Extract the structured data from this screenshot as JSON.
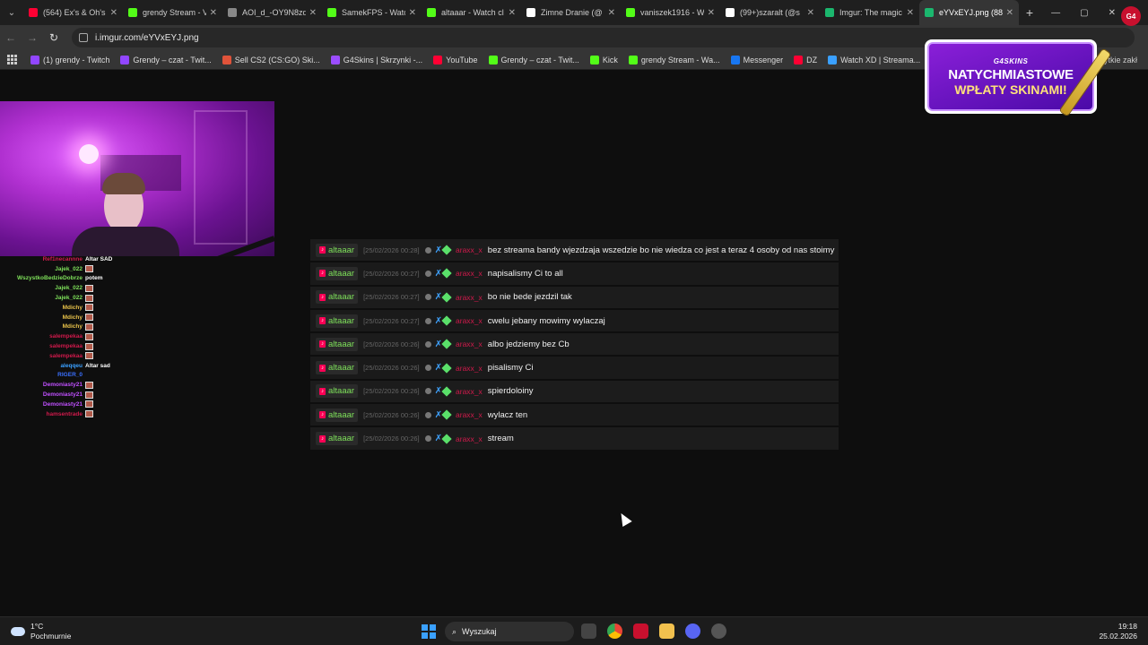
{
  "browser": {
    "tabs": [
      {
        "label": "(564) Ex's & Oh's",
        "icon": "youtube-icon",
        "color": "#ff0033"
      },
      {
        "label": "grendy Stream - V",
        "icon": "kick-icon",
        "color": "#53fc18"
      },
      {
        "label": "AOI_d_-OY9N8zd",
        "icon": "globe-icon",
        "color": "#888888"
      },
      {
        "label": "SamekFPS - Watc",
        "icon": "kick-icon",
        "color": "#53fc18"
      },
      {
        "label": "altaaar - Watch cl",
        "icon": "kick-icon",
        "color": "#53fc18"
      },
      {
        "label": "Zimne Dranie (@",
        "icon": "tiktok-icon",
        "color": "#ffffff"
      },
      {
        "label": "vaniszek1916 - W",
        "icon": "kick-icon",
        "color": "#53fc18"
      },
      {
        "label": "(99+)szaralt (@s",
        "icon": "tiktok-icon",
        "color": "#ffffff"
      },
      {
        "label": "Imgur: The magic",
        "icon": "imgur-icon",
        "color": "#1bb76e"
      },
      {
        "label": "eYVxEYJ.png (88",
        "icon": "image-icon",
        "color": "#1bb76e",
        "active": true
      }
    ],
    "url": "i.imgur.com/eYVxEYJ.png",
    "bookmarks": [
      {
        "label": "(1) grendy - Twitch",
        "color": "#9146ff"
      },
      {
        "label": "Grendy – czat - Twit...",
        "color": "#9146ff"
      },
      {
        "label": "Sell CS2 (CS:GO) Ski...",
        "color": "#e0533a"
      },
      {
        "label": "G4Skins | Skrzynki -...",
        "color": "#9b4dff"
      },
      {
        "label": "YouTube",
        "color": "#ff0033"
      },
      {
        "label": "Grendy – czat - Twit...",
        "color": "#53fc18"
      },
      {
        "label": "Kick",
        "color": "#53fc18"
      },
      {
        "label": "grendy Stream - Wa...",
        "color": "#53fc18"
      },
      {
        "label": "Messenger",
        "color": "#1877f2"
      },
      {
        "label": "DZ",
        "color": "#ff0033"
      },
      {
        "label": "Watch XD | Streama...",
        "color": "#3aa0ff"
      }
    ],
    "all_bookmarks": "ytkie zakł"
  },
  "promo": {
    "brand": "G4SKINS",
    "line1": "NATYCHMIASTOWE",
    "line2": "WPŁATY SKINAMI!",
    "ext_badge": "G4"
  },
  "side_chat": [
    {
      "name": "Ref1necannne",
      "msg": "Altar SAD",
      "color": "#d11a4c",
      "emote": false
    },
    {
      "name": "Jajek_022",
      "msg": "",
      "color": "#7ee05a",
      "emote": true
    },
    {
      "name": "WszystkoBedzieDobrze",
      "msg": "potem",
      "color": "#7ee05a",
      "emote": false
    },
    {
      "name": "Jajek_022",
      "msg": "",
      "color": "#7ee05a",
      "emote": true
    },
    {
      "name": "Jajek_022",
      "msg": "",
      "color": "#7ee05a",
      "emote": true
    },
    {
      "name": "Mdichy",
      "msg": "",
      "color": "#e8c24a",
      "emote": true
    },
    {
      "name": "Mdichy",
      "msg": "",
      "color": "#e8c24a",
      "emote": true
    },
    {
      "name": "Mdichy",
      "msg": "",
      "color": "#e8c24a",
      "emote": true
    },
    {
      "name": "salempekaa",
      "msg": "",
      "color": "#d11a4c",
      "emote": true
    },
    {
      "name": "salempekaa",
      "msg": "",
      "color": "#d11a4c",
      "emote": true
    },
    {
      "name": "salempekaa",
      "msg": "",
      "color": "#d11a4c",
      "emote": true
    },
    {
      "name": "aleqqeu",
      "msg": "Altar sad",
      "color": "#3aa0ff",
      "emote": false
    },
    {
      "name": "RIGER_0",
      "msg": "",
      "color": "#3a70ff",
      "emote": false
    },
    {
      "name": "Demoniasty21",
      "msg": "",
      "color": "#c050ff",
      "emote": true
    },
    {
      "name": "Demoniasty21",
      "msg": "",
      "color": "#c050ff",
      "emote": true
    },
    {
      "name": "Demoniasty21",
      "msg": "",
      "color": "#c050ff",
      "emote": true
    },
    {
      "name": "hamsentrade",
      "msg": "",
      "color": "#d11a4c",
      "emote": true
    }
  ],
  "chat_log": [
    {
      "user": "altaaar",
      "ts": "[25/02/2026 00:28]",
      "mod": "araxx_x",
      "text": "bez streama bandy wjezdzaja wszedzie bo nie wiedza co jest a teraz 4 osoby od nas stoimy"
    },
    {
      "user": "altaaar",
      "ts": "[25/02/2026 00:27]",
      "mod": "araxx_x",
      "text": "napisalismy Ci to all"
    },
    {
      "user": "altaaar",
      "ts": "[25/02/2026 00:27]",
      "mod": "araxx_x",
      "text": "bo nie bede jezdzil tak"
    },
    {
      "user": "altaaar",
      "ts": "[25/02/2026 00:27]",
      "mod": "araxx_x",
      "text": "cwelu jebany mowimy wylaczaj"
    },
    {
      "user": "altaaar",
      "ts": "[25/02/2026 00:26]",
      "mod": "araxx_x",
      "text": "albo jedziemy bez Cb"
    },
    {
      "user": "altaaar",
      "ts": "[25/02/2026 00:26]",
      "mod": "araxx_x",
      "text": "pisalismy Ci"
    },
    {
      "user": "altaaar",
      "ts": "[25/02/2026 00:26]",
      "mod": "araxx_x",
      "text": "spierdoloiny"
    },
    {
      "user": "altaaar",
      "ts": "[25/02/2026 00:26]",
      "mod": "araxx_x",
      "text": "wylacz ten"
    },
    {
      "user": "altaaar",
      "ts": "[25/02/2026 00:26]",
      "mod": "araxx_x",
      "text": "stream"
    }
  ],
  "taskbar": {
    "temp": "1°C",
    "weather": "Pochmurnie",
    "search_placeholder": "Wyszukaj",
    "time": "19:18",
    "date": "25.02.2026"
  }
}
